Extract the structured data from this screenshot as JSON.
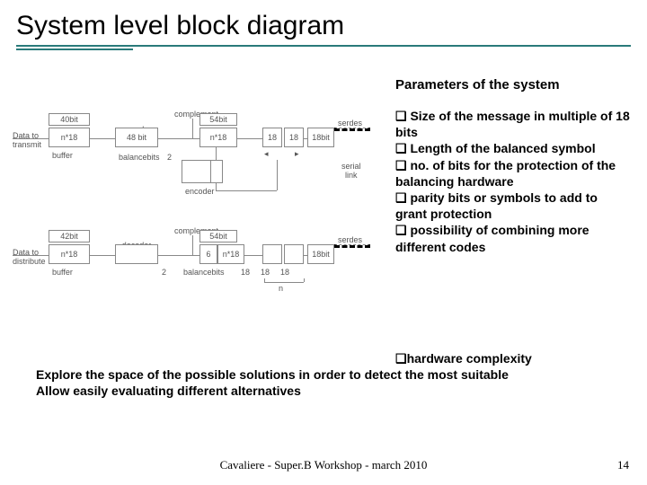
{
  "title": "System level block diagram",
  "subhead": "Parameters of the system",
  "bullet_glyph": "❑",
  "params": [
    "Size of the message in multiple of 18 bits",
    "Length of the balanced symbol",
    "no. of bits for the protection of the balancing hardware",
    "parity bits or symbols to add to grant protection",
    "possibility of combining more different codes"
  ],
  "bottom": {
    "bullet": "hardware complexity",
    "line1": "Explore the space of the possible solutions in order to detect the most suitable",
    "line2": "Allow easily evaluating different alternatives"
  },
  "footer": "Cavaliere - Super.B Workshop - march 2010",
  "page_number": "14",
  "diagram": {
    "top": {
      "data_label1": "Data to",
      "data_label2": "transmit",
      "buffer": "buffer",
      "forty": "40bit",
      "n18_sub": "n*18",
      "encoder": "encoder",
      "fortyeight": "48 bit",
      "balancebits": "balancebits",
      "two": "2",
      "complement": "complement",
      "fiftyfour": "54bit",
      "n18": "n*18",
      "box18a": "18",
      "box18b": "18",
      "eighteenbit": "18bit",
      "serdes": "serdes",
      "serial_link1": "serial",
      "serial_link2": "link",
      "encoder2": "encoder",
      "down_left": "◂",
      "down_right": "▸"
    },
    "bot": {
      "data_label1": "Data to",
      "data_label2": "distribute",
      "buffer": "buffer",
      "fortytwo": "42bit",
      "n18_sub": "n*18",
      "decoder": "decoder",
      "complement": "complement",
      "fiftyfour": "54bit",
      "six": "6",
      "n18": "n*18",
      "balancebits": "balancebits",
      "eighteen2": "18",
      "eighteen3": "18",
      "eighteen4": "18",
      "eighteenbit": "18bit",
      "serdes": "serdes",
      "two": "2",
      "n": "n"
    }
  }
}
